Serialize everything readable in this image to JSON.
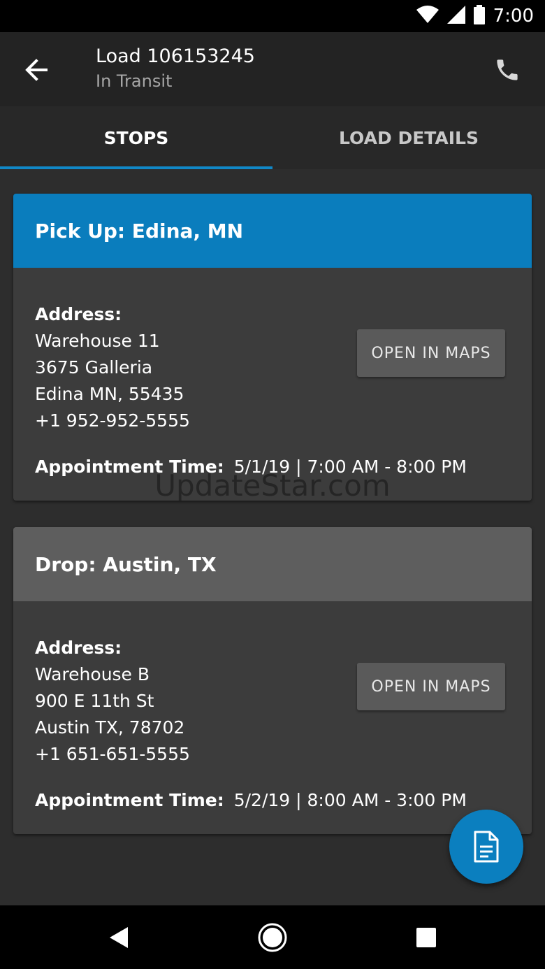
{
  "status_bar": {
    "time": "7:00"
  },
  "app_bar": {
    "title": "Load 106153245",
    "subtitle": "In Transit"
  },
  "tabs": [
    {
      "label": "STOPS",
      "active": true
    },
    {
      "label": "LOAD DETAILS",
      "active": false
    }
  ],
  "stops": [
    {
      "header": "Pick Up: Edina, MN",
      "header_color": "#0a7dbd",
      "address_label": "Address:",
      "address_lines": [
        "Warehouse 11",
        "3675 Galleria",
        "Edina MN, 55435",
        "+1 952-952-5555"
      ],
      "maps_button": "OPEN IN MAPS",
      "appointment_label": "Appointment Time:",
      "appointment_value": "5/1/19 | 7:00 AM - 8:00 PM"
    },
    {
      "header": "Drop: Austin, TX",
      "header_color": "#5e5e5e",
      "address_label": "Address:",
      "address_lines": [
        "Warehouse B",
        "900 E 11th St",
        "Austin TX, 78702",
        "+1 651-651-5555"
      ],
      "maps_button": "OPEN IN MAPS",
      "appointment_label": "Appointment Time:",
      "appointment_value": "5/2/19 | 8:00 AM - 3:00 PM"
    }
  ],
  "watermark": "UpdateStar.com",
  "colors": {
    "accent": "#1188c7",
    "fab": "#0b7fbf"
  }
}
